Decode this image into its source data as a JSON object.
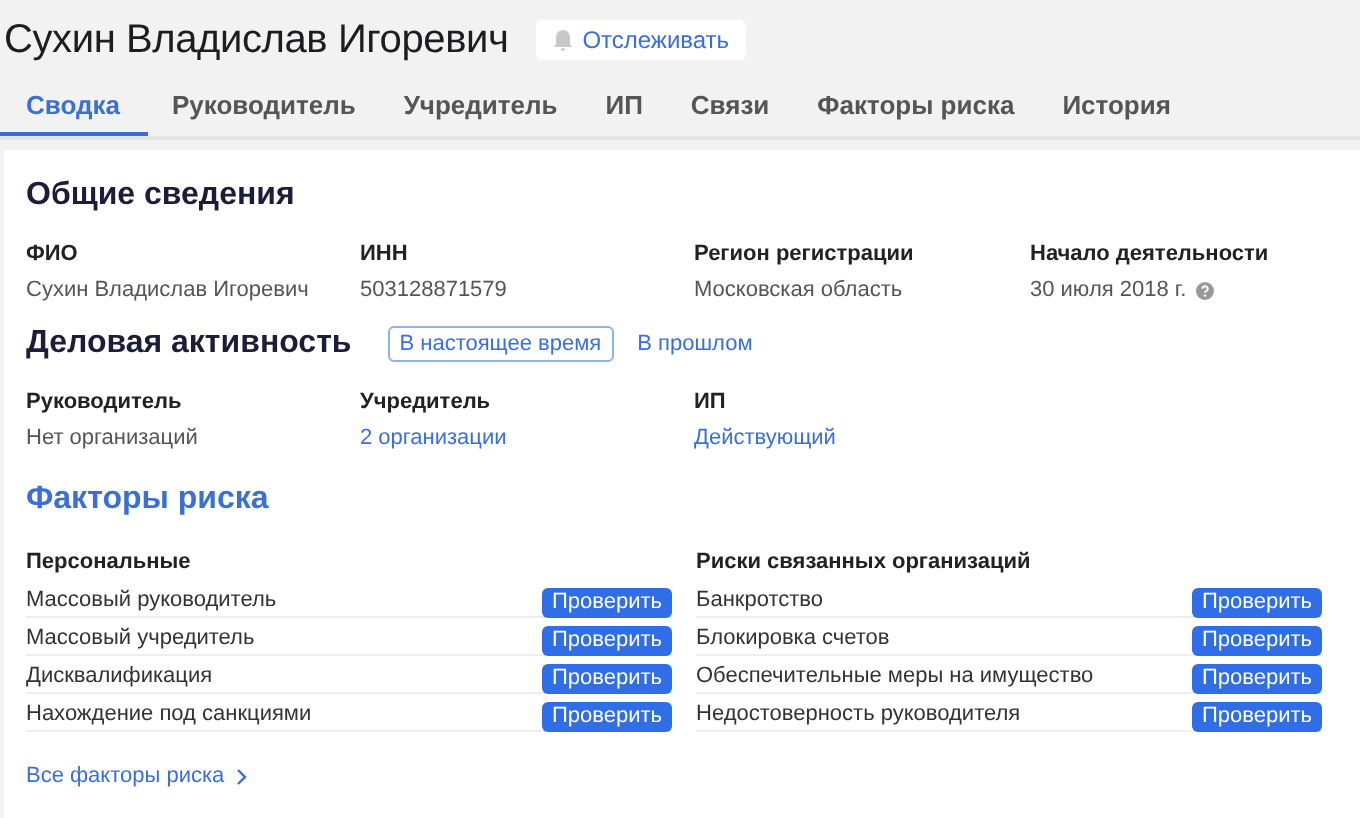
{
  "header": {
    "title": "Сухин Владислав Игоревич",
    "follow_button": "Отслеживать"
  },
  "tabs": [
    {
      "label": "Сводка",
      "selected": true
    },
    {
      "label": "Руководитель",
      "selected": false
    },
    {
      "label": "Учредитель",
      "selected": false
    },
    {
      "label": "ИП",
      "selected": false
    },
    {
      "label": "Связи",
      "selected": false
    },
    {
      "label": "Факторы риска",
      "selected": false
    },
    {
      "label": "История",
      "selected": false
    }
  ],
  "general": {
    "title": "Общие сведения",
    "fields": [
      {
        "label": "ФИО",
        "value": "Сухин Владислав Игоревич",
        "help": false
      },
      {
        "label": "ИНН",
        "value": "503128871579",
        "help": false
      },
      {
        "label": "Регион регистрации",
        "value": "Московская область",
        "help": false
      },
      {
        "label": "Начало деятельности",
        "value": "30 июля 2018 г.",
        "help": true
      }
    ]
  },
  "business": {
    "title": "Деловая активность",
    "periods": [
      {
        "label": "В настоящее время",
        "selected": true
      },
      {
        "label": "В прошлом",
        "selected": false
      }
    ],
    "fields": [
      {
        "label": "Руководитель",
        "value": "Нет организаций",
        "link": false
      },
      {
        "label": "Учредитель",
        "value": "2 организации",
        "link": true
      },
      {
        "label": "ИП",
        "value": "Действующий",
        "link": true
      }
    ]
  },
  "risks": {
    "title": "Факторы риска",
    "groups": [
      {
        "title": "Персональные",
        "items": [
          {
            "label": "Массовый руководитель",
            "button": "Проверить"
          },
          {
            "label": "Массовый учредитель",
            "button": "Проверить"
          },
          {
            "label": "Дисквалификация",
            "button": "Проверить"
          },
          {
            "label": "Нахождение под санкциями",
            "button": "Проверить"
          }
        ]
      },
      {
        "title": "Риски связанных организаций",
        "items": [
          {
            "label": "Банкротство",
            "button": "Проверить"
          },
          {
            "label": "Блокировка счетов",
            "button": "Проверить"
          },
          {
            "label": "Обеспечительные меры на имущество",
            "button": "Проверить"
          },
          {
            "label": "Недостоверность руководителя",
            "button": "Проверить"
          }
        ]
      }
    ],
    "all_link": "Все факторы риска"
  }
}
